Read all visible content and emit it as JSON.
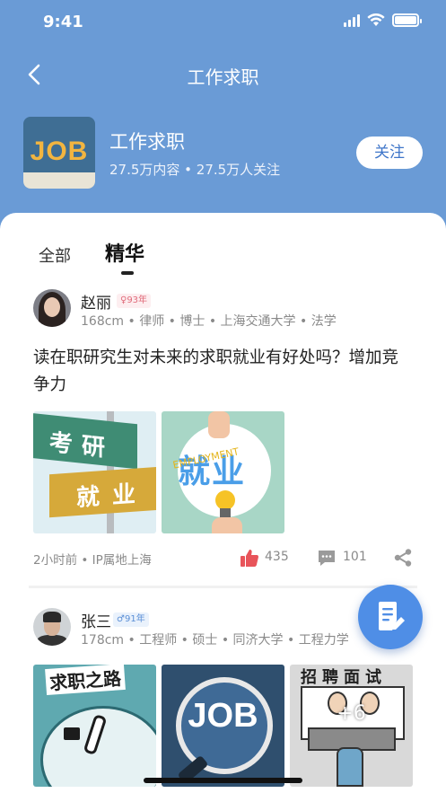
{
  "status_bar": {
    "time": "9:41"
  },
  "nav": {
    "title": "工作求职"
  },
  "topic": {
    "thumb_text": "JOB",
    "title": "工作求职",
    "stats": "27.5万内容 • 27.5万人关注",
    "follow_label": "关注"
  },
  "tabs": [
    {
      "label": "全部",
      "active": false
    },
    {
      "label": "精华",
      "active": true
    }
  ],
  "posts": [
    {
      "user_name": "赵丽",
      "gender": "female",
      "badge": "♀93年",
      "meta": "168cm • 律师 • 博士 • 上海交通大学 • 法学",
      "title": "读在职研究生对未来的求职就业有好处吗？增加竞争力",
      "images": [
        {
          "icon": "signpost-image",
          "text_top": "考研",
          "text_bottom": "就业"
        },
        {
          "icon": "employment-image",
          "text": "就业",
          "sub": "EMPLOYMENT"
        }
      ],
      "time": "2小时前 • IP属地上海",
      "likes": "435",
      "comments": "101"
    },
    {
      "user_name": "张三",
      "gender": "male",
      "badge": "♂91年",
      "meta": "178cm • 工程师 • 硕士 • 同济大学 • 工程力学",
      "images": [
        {
          "icon": "career-road-image",
          "text": "求职之路"
        },
        {
          "icon": "job-magnifier-image",
          "text": "JOB"
        },
        {
          "icon": "interview-image",
          "text": "招聘面试",
          "more": "+6"
        }
      ]
    }
  ],
  "colors": {
    "header_bg": "#6a9bd6",
    "accent": "#4f8ee6",
    "follow_text": "#3f76c9",
    "like": "#e8545a",
    "meta_text": "#8a8a8a"
  },
  "icons": [
    "back-icon",
    "signal-icon",
    "wifi-icon",
    "battery-icon",
    "like-icon",
    "comment-icon",
    "share-icon",
    "compose-icon"
  ]
}
